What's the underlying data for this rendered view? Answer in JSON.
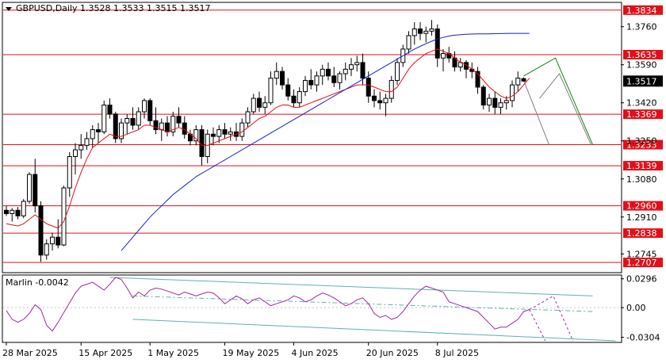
{
  "header": {
    "symbol_line": "GBPUSD,Daily  1.3528 1.3533 1.3515 1.3517"
  },
  "indicator": {
    "label": "Marlin -0.0042",
    "scale_labels": [
      "0.0296",
      "0.00",
      "-0.0304"
    ]
  },
  "colors": {
    "bull_candle": "#ffffff",
    "bear_candle": "#000000",
    "moving_average_fast": "#e0101a",
    "moving_average_slow": "#1020d0",
    "level_line": "#e0101a",
    "level_label_bg": "#e0101a",
    "oscillator": "#9a2aa0",
    "channel": "#5fb0b0",
    "forecast_green": "#108010",
    "forecast_gray": "#808080"
  },
  "chart_data": {
    "type": "candlestick",
    "title": "GBPUSD,Daily",
    "ylim": [
      1.2665,
      1.3865
    ],
    "y_ticks": [
      "1.3760",
      "1.3590",
      "1.3420",
      "1.3250",
      "1.3080",
      "1.2910",
      "1.2745"
    ],
    "current_price": "1.3517",
    "levels": [
      {
        "label": "1.3834",
        "value": 1.3834
      },
      {
        "label": "1.3635",
        "value": 1.3635
      },
      {
        "label": "1.3369",
        "value": 1.3369
      },
      {
        "label": "1.3233",
        "value": 1.3233
      },
      {
        "label": "1.3139",
        "value": 1.3139
      },
      {
        "label": "1.2960",
        "value": 1.296
      },
      {
        "label": "1.2838",
        "value": 1.2838
      },
      {
        "label": "1.2707",
        "value": 1.2707
      }
    ],
    "x_labels": [
      "28 Mar 2025",
      "15 Apr 2025",
      "1 May 2025",
      "19 May 2025",
      "4 Jun 2025",
      "20 Jun 2025",
      "8 Jul 2025"
    ],
    "candles": [
      [
        1.294,
        1.296,
        1.2915,
        1.2925
      ],
      [
        1.2925,
        1.295,
        1.289,
        1.294
      ],
      [
        1.294,
        1.2955,
        1.29,
        1.2915
      ],
      [
        1.2915,
        1.299,
        1.2905,
        1.298
      ],
      [
        1.298,
        1.311,
        1.297,
        1.31
      ],
      [
        1.31,
        1.317,
        1.293,
        1.296
      ],
      [
        1.296,
        1.298,
        1.271,
        1.274
      ],
      [
        1.274,
        1.281,
        1.272,
        1.279
      ],
      [
        1.279,
        1.284,
        1.276,
        1.282
      ],
      [
        1.282,
        1.29,
        1.277,
        1.2785
      ],
      [
        1.2785,
        1.305,
        1.278,
        1.304
      ],
      [
        1.304,
        1.32,
        1.3,
        1.318
      ],
      [
        1.318,
        1.324,
        1.31,
        1.321
      ],
      [
        1.321,
        1.328,
        1.317,
        1.323
      ],
      [
        1.323,
        1.329,
        1.321,
        1.326
      ],
      [
        1.326,
        1.332,
        1.322,
        1.33
      ],
      [
        1.33,
        1.333,
        1.324,
        1.329
      ],
      [
        1.329,
        1.343,
        1.328,
        1.341
      ],
      [
        1.341,
        1.344,
        1.335,
        1.337
      ],
      [
        1.337,
        1.338,
        1.324,
        1.326
      ],
      [
        1.326,
        1.335,
        1.324,
        1.333
      ],
      [
        1.333,
        1.337,
        1.328,
        1.335
      ],
      [
        1.335,
        1.34,
        1.33,
        1.332
      ],
      [
        1.332,
        1.34,
        1.33,
        1.338
      ],
      [
        1.338,
        1.344,
        1.335,
        1.343
      ],
      [
        1.343,
        1.344,
        1.332,
        1.334
      ],
      [
        1.334,
        1.34,
        1.328,
        1.33
      ],
      [
        1.33,
        1.335,
        1.325,
        1.333
      ],
      [
        1.333,
        1.336,
        1.327,
        1.329
      ],
      [
        1.329,
        1.338,
        1.327,
        1.336
      ],
      [
        1.336,
        1.34,
        1.331,
        1.333
      ],
      [
        1.333,
        1.336,
        1.326,
        1.328
      ],
      [
        1.328,
        1.33,
        1.323,
        1.325
      ],
      [
        1.325,
        1.332,
        1.323,
        1.33
      ],
      [
        1.33,
        1.332,
        1.314,
        1.318
      ],
      [
        1.318,
        1.33,
        1.315,
        1.328
      ],
      [
        1.328,
        1.331,
        1.323,
        1.327
      ],
      [
        1.327,
        1.332,
        1.324,
        1.33
      ],
      [
        1.33,
        1.333,
        1.326,
        1.328
      ],
      [
        1.328,
        1.331,
        1.325,
        1.329
      ],
      [
        1.329,
        1.333,
        1.325,
        1.327
      ],
      [
        1.327,
        1.335,
        1.325,
        1.333
      ],
      [
        1.333,
        1.34,
        1.331,
        1.338
      ],
      [
        1.338,
        1.346,
        1.337,
        1.344
      ],
      [
        1.344,
        1.347,
        1.338,
        1.34
      ],
      [
        1.34,
        1.345,
        1.337,
        1.342
      ],
      [
        1.342,
        1.356,
        1.341,
        1.353
      ],
      [
        1.353,
        1.36,
        1.35,
        1.356
      ],
      [
        1.356,
        1.358,
        1.348,
        1.35
      ],
      [
        1.35,
        1.353,
        1.343,
        1.345
      ],
      [
        1.345,
        1.348,
        1.34,
        1.342
      ],
      [
        1.342,
        1.349,
        1.34,
        1.347
      ],
      [
        1.347,
        1.354,
        1.345,
        1.352
      ],
      [
        1.352,
        1.357,
        1.348,
        1.35
      ],
      [
        1.35,
        1.356,
        1.347,
        1.354
      ],
      [
        1.354,
        1.359,
        1.35,
        1.357
      ],
      [
        1.357,
        1.36,
        1.352,
        1.354
      ],
      [
        1.354,
        1.358,
        1.349,
        1.351
      ],
      [
        1.351,
        1.356,
        1.348,
        1.355
      ],
      [
        1.355,
        1.36,
        1.352,
        1.357
      ],
      [
        1.357,
        1.362,
        1.354,
        1.359
      ],
      [
        1.359,
        1.363,
        1.356,
        1.36
      ],
      [
        1.36,
        1.364,
        1.35,
        1.353
      ],
      [
        1.353,
        1.356,
        1.342,
        1.345
      ],
      [
        1.345,
        1.348,
        1.34,
        1.343
      ],
      [
        1.343,
        1.347,
        1.339,
        1.342
      ],
      [
        1.342,
        1.346,
        1.336,
        1.344
      ],
      [
        1.344,
        1.354,
        1.342,
        1.352
      ],
      [
        1.352,
        1.362,
        1.35,
        1.36
      ],
      [
        1.36,
        1.368,
        1.358,
        1.366
      ],
      [
        1.366,
        1.374,
        1.364,
        1.372
      ],
      [
        1.372,
        1.378,
        1.368,
        1.375
      ],
      [
        1.375,
        1.378,
        1.37,
        1.373
      ],
      [
        1.373,
        1.376,
        1.369,
        1.374
      ],
      [
        1.374,
        1.379,
        1.372,
        1.375
      ],
      [
        1.375,
        1.377,
        1.358,
        1.362
      ],
      [
        1.362,
        1.366,
        1.356,
        1.364
      ],
      [
        1.364,
        1.367,
        1.36,
        1.362
      ],
      [
        1.362,
        1.365,
        1.356,
        1.358
      ],
      [
        1.358,
        1.362,
        1.356,
        1.36
      ],
      [
        1.36,
        1.361,
        1.353,
        1.357
      ],
      [
        1.357,
        1.36,
        1.353,
        1.356
      ],
      [
        1.356,
        1.358,
        1.346,
        1.349
      ],
      [
        1.349,
        1.35,
        1.339,
        1.341
      ],
      [
        1.341,
        1.346,
        1.338,
        1.344
      ],
      [
        1.344,
        1.347,
        1.337,
        1.34
      ],
      [
        1.34,
        1.344,
        1.337,
        1.342
      ],
      [
        1.342,
        1.345,
        1.339,
        1.343
      ],
      [
        1.343,
        1.352,
        1.34,
        1.35
      ],
      [
        1.35,
        1.356,
        1.347,
        1.353
      ],
      [
        1.3528,
        1.3533,
        1.3515,
        1.3517
      ]
    ],
    "series": [
      {
        "values": [
          1.288,
          1.2875,
          1.287,
          1.288,
          1.29,
          1.292,
          1.29,
          1.288,
          1.287,
          1.286,
          1.289,
          1.296,
          1.304,
          1.311,
          1.317,
          1.322,
          1.324,
          1.326,
          1.328,
          1.327,
          1.327,
          1.328,
          1.329,
          1.33,
          1.332,
          1.332,
          1.331,
          1.33,
          1.329,
          1.33,
          1.331,
          1.33,
          1.328,
          1.326,
          1.323,
          1.323,
          1.324,
          1.325,
          1.326,
          1.327,
          1.328,
          1.329,
          1.331,
          1.333,
          1.335,
          1.336,
          1.338,
          1.34,
          1.341,
          1.341,
          1.34,
          1.34,
          1.341,
          1.342,
          1.343,
          1.344,
          1.345,
          1.346,
          1.347,
          1.348,
          1.349,
          1.35,
          1.35,
          1.35,
          1.349,
          1.348,
          1.347,
          1.347,
          1.349,
          1.353,
          1.357,
          1.36,
          1.362,
          1.364,
          1.365,
          1.366,
          1.365,
          1.364,
          1.362,
          1.36,
          1.359,
          1.357,
          1.355,
          1.352,
          1.349,
          1.347,
          1.345,
          1.344,
          1.345,
          1.347,
          1.35,
          1.353
        ]
      },
      {
        "values": [
          null,
          null,
          null,
          null,
          null,
          null,
          null,
          null,
          null,
          null,
          null,
          null,
          null,
          null,
          null,
          null,
          null,
          null,
          null,
          null,
          1.276,
          1.279,
          1.282,
          1.285,
          1.288,
          1.291,
          1.2935,
          1.296,
          1.2985,
          1.301,
          1.303,
          1.305,
          1.307,
          1.309,
          1.3105,
          1.312,
          1.3135,
          1.315,
          1.3165,
          1.318,
          1.3195,
          1.321,
          1.3225,
          1.324,
          1.3255,
          1.327,
          1.3285,
          1.33,
          1.3315,
          1.333,
          1.3345,
          1.336,
          1.3375,
          1.339,
          1.3405,
          1.342,
          1.3435,
          1.345,
          1.3465,
          1.348,
          1.3495,
          1.351,
          1.3525,
          1.354,
          1.3555,
          1.357,
          1.3585,
          1.36,
          1.3615,
          1.363,
          1.3645,
          1.366,
          1.3672,
          1.3684,
          1.3695,
          1.3705,
          1.3712,
          1.3718,
          1.3722,
          1.3724,
          1.3726,
          1.3727,
          1.3728,
          1.3728,
          1.3728,
          1.3729,
          1.3729,
          1.373,
          1.373,
          1.373,
          1.373,
          1.373
        ]
      }
    ],
    "oscillator": {
      "name": "Marlin",
      "ylim": [
        -0.034,
        0.031
      ],
      "values": [
        -0.003,
        -0.012,
        -0.015,
        -0.012,
        -0.006,
        0.003,
        -0.002,
        -0.018,
        -0.024,
        -0.015,
        -0.005,
        0.005,
        0.015,
        0.022,
        0.024,
        0.026,
        0.022,
        0.018,
        0.024,
        0.031,
        0.029,
        0.02,
        0.01,
        0.016,
        0.012,
        0.018,
        0.02,
        0.019,
        0.017,
        0.015,
        0.013,
        0.016,
        0.014,
        0.012,
        0.014,
        0.016,
        0.015,
        0.01,
        0.004,
        0.008,
        0.012,
        0.009,
        0.004,
        0.008,
        0.01,
        0.006,
        0.002,
        0.004,
        0.006,
        0.008,
        0.012,
        0.01,
        0.006,
        0.008,
        0.012,
        0.015,
        0.013,
        0.01,
        0.006,
        0.002,
        0.004,
        0.008,
        0.01,
        0.004,
        -0.006,
        -0.01,
        -0.008,
        -0.012,
        -0.01,
        -0.004,
        0.004,
        0.012,
        0.018,
        0.022,
        0.02,
        0.018,
        0.016,
        0.006,
        0.004,
        0.002,
        0.0,
        -0.002,
        -0.004,
        -0.01,
        -0.016,
        -0.022,
        -0.02,
        -0.02,
        -0.016,
        -0.012,
        -0.004,
        -0.002
      ]
    }
  }
}
